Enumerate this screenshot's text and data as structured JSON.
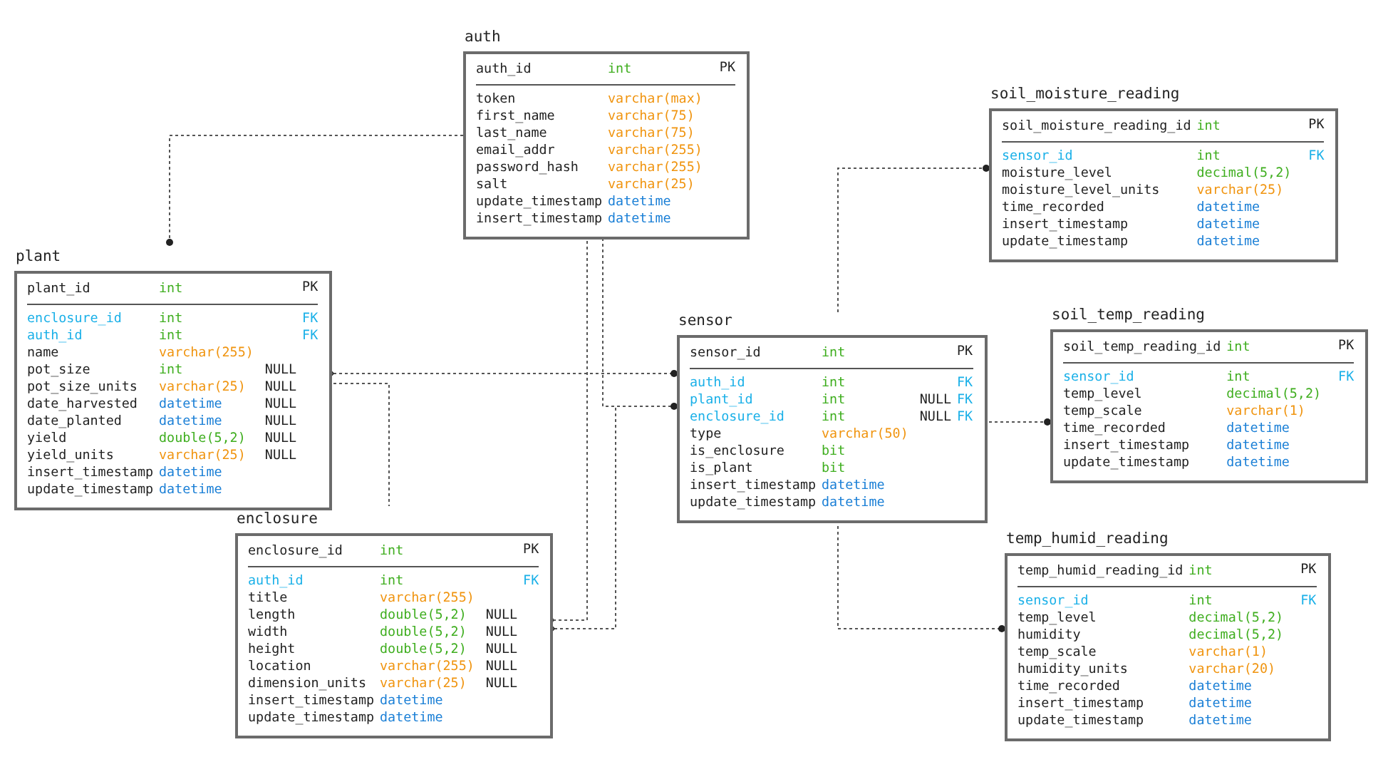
{
  "tables": [
    {
      "name": "auth",
      "primary": {
        "name": "auth_id",
        "type": "int",
        "color": "#3fae1f",
        "key": "PK"
      },
      "columns": [
        {
          "name": "token",
          "type": "varchar(max)",
          "color": "#f0940f",
          "foreign": false
        },
        {
          "name": "first_name",
          "type": "varchar(75)",
          "color": "#f0940f",
          "foreign": false
        },
        {
          "name": "last_name",
          "type": "varchar(75)",
          "color": "#f0940f",
          "foreign": false
        },
        {
          "name": "email_addr",
          "type": "varchar(255)",
          "color": "#f0940f",
          "foreign": false
        },
        {
          "name": "password_hash",
          "type": "varchar(255)",
          "color": "#f0940f",
          "foreign": false
        },
        {
          "name": "salt",
          "type": "varchar(25)",
          "color": "#f0940f",
          "foreign": false
        },
        {
          "name": "update_timestamp",
          "type": "datetime",
          "color": "#1a7fd6",
          "foreign": false
        },
        {
          "name": "insert_timestamp",
          "type": "datetime",
          "color": "#1a7fd6",
          "foreign": false
        }
      ]
    },
    {
      "name": "soil_moisture_reading",
      "primary": {
        "name": "soil_moisture_reading_id",
        "type": "int",
        "color": "#3fae1f",
        "key": "PK"
      },
      "columns": [
        {
          "name": "sensor_id",
          "type": "int",
          "color": "#3fae1f",
          "key": "FK",
          "foreign": true
        },
        {
          "name": "moisture_level",
          "type": "decimal(5,2)",
          "color": "#3fae1f",
          "foreign": false
        },
        {
          "name": "moisture_level_units",
          "type": "varchar(25)",
          "color": "#f0940f",
          "foreign": false
        },
        {
          "name": "time_recorded",
          "type": "datetime",
          "color": "#1a7fd6",
          "foreign": false
        },
        {
          "name": "insert_timestamp",
          "type": "datetime",
          "color": "#1a7fd6",
          "foreign": false
        },
        {
          "name": "update_timestamp",
          "type": "datetime",
          "color": "#1a7fd6",
          "foreign": false
        }
      ]
    },
    {
      "name": "plant",
      "primary": {
        "name": "plant_id",
        "type": "int",
        "color": "#3fae1f",
        "key": "PK"
      },
      "columns": [
        {
          "name": "enclosure_id",
          "type": "int",
          "color": "#3fae1f",
          "key": "FK",
          "foreign": true
        },
        {
          "name": "auth_id",
          "type": "int",
          "color": "#3fae1f",
          "key": "FK",
          "foreign": true
        },
        {
          "name": "name",
          "type": "varchar(255)",
          "color": "#f0940f",
          "foreign": false
        },
        {
          "name": "pot_size",
          "type": "int",
          "color": "#3fae1f",
          "null": "NULL",
          "foreign": false
        },
        {
          "name": "pot_size_units",
          "type": "varchar(25)",
          "color": "#f0940f",
          "null": "NULL",
          "foreign": false
        },
        {
          "name": "date_harvested",
          "type": "datetime",
          "color": "#1a7fd6",
          "null": "NULL",
          "foreign": false
        },
        {
          "name": "date_planted",
          "type": "datetime",
          "color": "#1a7fd6",
          "null": "NULL",
          "foreign": false
        },
        {
          "name": "yield",
          "type": "double(5,2)",
          "color": "#3fae1f",
          "null": "NULL",
          "foreign": false
        },
        {
          "name": "yield_units",
          "type": "varchar(25)",
          "color": "#f0940f",
          "null": "NULL",
          "foreign": false
        },
        {
          "name": "insert_timestamp",
          "type": "datetime",
          "color": "#1a7fd6",
          "foreign": false
        },
        {
          "name": "update_timestamp",
          "type": "datetime",
          "color": "#1a7fd6",
          "foreign": false
        }
      ]
    },
    {
      "name": "sensor",
      "primary": {
        "name": "sensor_id",
        "type": "int",
        "color": "#3fae1f",
        "key": "PK"
      },
      "columns": [
        {
          "name": "auth_id",
          "type": "int",
          "color": "#3fae1f",
          "key": "FK",
          "foreign": true
        },
        {
          "name": "plant_id",
          "type": "int",
          "color": "#3fae1f",
          "null": "NULL",
          "key": "FK",
          "foreign": true
        },
        {
          "name": "enclosure_id",
          "type": "int",
          "color": "#3fae1f",
          "null": "NULL",
          "key": "FK",
          "foreign": true
        },
        {
          "name": "type",
          "type": "varchar(50)",
          "color": "#f0940f",
          "foreign": false
        },
        {
          "name": "is_enclosure",
          "type": "bit",
          "color": "#3fae1f",
          "foreign": false
        },
        {
          "name": "is_plant",
          "type": "bit",
          "color": "#3fae1f",
          "foreign": false
        },
        {
          "name": "insert_timestamp",
          "type": "datetime",
          "color": "#1a7fd6",
          "foreign": false
        },
        {
          "name": "update_timestamp",
          "type": "datetime",
          "color": "#1a7fd6",
          "foreign": false
        }
      ]
    },
    {
      "name": "soil_temp_reading",
      "primary": {
        "name": "soil_temp_reading_id",
        "type": "int",
        "color": "#3fae1f",
        "key": "PK"
      },
      "columns": [
        {
          "name": "sensor_id",
          "type": "int",
          "color": "#3fae1f",
          "key": "FK",
          "foreign": true
        },
        {
          "name": "temp_level",
          "type": "decimal(5,2)",
          "color": "#3fae1f",
          "foreign": false
        },
        {
          "name": "temp_scale",
          "type": "varchar(1)",
          "color": "#f0940f",
          "foreign": false
        },
        {
          "name": "time_recorded",
          "type": "datetime",
          "color": "#1a7fd6",
          "foreign": false
        },
        {
          "name": "insert_timestamp",
          "type": "datetime",
          "color": "#1a7fd6",
          "foreign": false
        },
        {
          "name": "update_timestamp",
          "type": "datetime",
          "color": "#1a7fd6",
          "foreign": false
        }
      ]
    },
    {
      "name": "enclosure",
      "primary": {
        "name": "enclosure_id",
        "type": "int",
        "color": "#3fae1f",
        "key": "PK"
      },
      "columns": [
        {
          "name": "auth_id",
          "type": "int",
          "color": "#3fae1f",
          "key": "FK",
          "foreign": true
        },
        {
          "name": "title",
          "type": "varchar(255)",
          "color": "#f0940f",
          "foreign": false
        },
        {
          "name": "length",
          "type": "double(5,2)",
          "color": "#3fae1f",
          "null": "NULL",
          "foreign": false
        },
        {
          "name": "width",
          "type": "double(5,2)",
          "color": "#3fae1f",
          "null": "NULL",
          "foreign": false
        },
        {
          "name": "height",
          "type": "double(5,2)",
          "color": "#3fae1f",
          "null": "NULL",
          "foreign": false
        },
        {
          "name": "location",
          "type": "varchar(255)",
          "color": "#f0940f",
          "null": "NULL",
          "foreign": false
        },
        {
          "name": "dimension_units",
          "type": "varchar(25)",
          "color": "#f0940f",
          "null": "NULL",
          "foreign": false
        },
        {
          "name": "insert_timestamp",
          "type": "datetime",
          "color": "#1a7fd6",
          "foreign": false
        },
        {
          "name": "update_timestamp",
          "type": "datetime",
          "color": "#1a7fd6",
          "foreign": false
        }
      ]
    },
    {
      "name": "temp_humid_reading",
      "primary": {
        "name": "temp_humid_reading_id",
        "type": "int",
        "color": "#3fae1f",
        "key": "PK"
      },
      "columns": [
        {
          "name": "sensor_id",
          "type": "int",
          "color": "#3fae1f",
          "key": "FK",
          "foreign": true
        },
        {
          "name": "temp_level",
          "type": "decimal(5,2)",
          "color": "#3fae1f",
          "foreign": false
        },
        {
          "name": "humidity",
          "type": "decimal(5,2)",
          "color": "#3fae1f",
          "foreign": false
        },
        {
          "name": "temp_scale",
          "type": "varchar(1)",
          "color": "#f0940f",
          "foreign": false
        },
        {
          "name": "humidity_units",
          "type": "varchar(20)",
          "color": "#f0940f",
          "foreign": false
        },
        {
          "name": "time_recorded",
          "type": "datetime",
          "color": "#1a7fd6",
          "foreign": false
        },
        {
          "name": "insert_timestamp",
          "type": "datetime",
          "color": "#1a7fd6",
          "foreign": false
        },
        {
          "name": "update_timestamp",
          "type": "datetime",
          "color": "#1a7fd6",
          "foreign": false
        }
      ]
    }
  ]
}
